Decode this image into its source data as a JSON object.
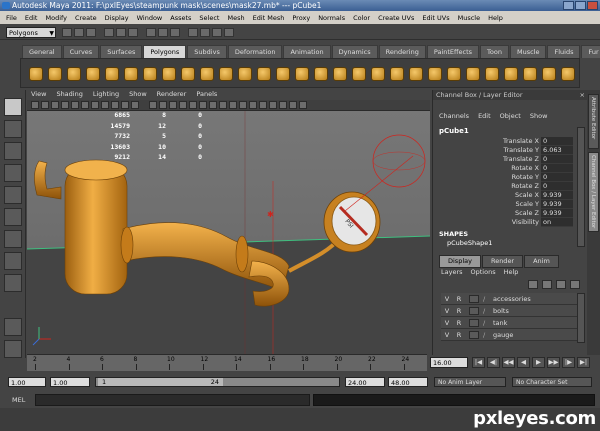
{
  "window": {
    "title": "Autodesk Maya 2011: F:\\pxlEyes\\steampunk mask\\scenes\\mask27.mb*   ---   pCube1"
  },
  "menubar": [
    "File",
    "Edit",
    "Modify",
    "Create",
    "Display",
    "Window",
    "Assets",
    "Select",
    "Mesh",
    "Edit Mesh",
    "Proxy",
    "Normals",
    "Color",
    "Create UVs",
    "Edit UVs",
    "Muscle",
    "Help"
  ],
  "status_line": {
    "mode": "Polygons"
  },
  "shelf": {
    "tabs": [
      "General",
      "Curves",
      "Surfaces",
      "Polygons",
      "Subdivs",
      "Deformation",
      "Animation",
      "Dynamics",
      "Rendering",
      "PaintEffects",
      "Toon",
      "Muscle",
      "Fluids",
      "Fur"
    ],
    "active_tab": "Polygons"
  },
  "viewport": {
    "menu": [
      "View",
      "Shading",
      "Lighting",
      "Show",
      "Renderer",
      "Panels"
    ],
    "hud_rows": [
      [
        "6865",
        "8",
        "0"
      ],
      [
        "14579",
        "12",
        "0"
      ],
      [
        "7732",
        "5",
        "0"
      ],
      [
        "13603",
        "10",
        "0"
      ],
      [
        "9212",
        "14",
        "0"
      ]
    ],
    "gauge_label": "PSI"
  },
  "channel_box": {
    "header": "Channel Box / Layer Editor",
    "menu": [
      "Channels",
      "Edit",
      "Object",
      "Show"
    ],
    "object_name": "pCube1",
    "attributes": [
      {
        "name": "Translate X",
        "value": "0"
      },
      {
        "name": "Translate Y",
        "value": "6.063"
      },
      {
        "name": "Translate Z",
        "value": "0"
      },
      {
        "name": "Rotate X",
        "value": "0"
      },
      {
        "name": "Rotate Y",
        "value": "0"
      },
      {
        "name": "Rotate Z",
        "value": "0"
      },
      {
        "name": "Scale X",
        "value": "9.939"
      },
      {
        "name": "Scale Y",
        "value": "9.939"
      },
      {
        "name": "Scale Z",
        "value": "9.939"
      },
      {
        "name": "Visibility",
        "value": "on"
      }
    ],
    "shapes_label": "SHAPES",
    "shape_name": "pCubeShape1"
  },
  "layer_editor": {
    "tabs": [
      "Display",
      "Render",
      "Anim"
    ],
    "active_tab": "Display",
    "menu": [
      "Layers",
      "Options",
      "Help"
    ],
    "layers": [
      {
        "v": "V",
        "r": "R",
        "name": "accessories"
      },
      {
        "v": "V",
        "r": "R",
        "name": "bolts"
      },
      {
        "v": "V",
        "r": "R",
        "name": "tank"
      },
      {
        "v": "V",
        "r": "R",
        "name": "gauge"
      }
    ]
  },
  "side_tabs": [
    "Attribute Editor",
    "Channel Box / Layer Editor"
  ],
  "time_slider": {
    "ticks": [
      "2",
      "4",
      "6",
      "8",
      "10",
      "12",
      "14",
      "16",
      "18",
      "20",
      "22",
      "24"
    ],
    "current_frame": "16.00"
  },
  "range_slider": {
    "start_time": "1.00",
    "playback_start": "1.00",
    "handle_start": "1",
    "handle_end": "24",
    "playback_end": "24.00",
    "end_time": "48.00",
    "anim_layer": "No Anim Layer",
    "character_set": "No Character Set"
  },
  "command_line": {
    "label": "MEL"
  },
  "watermark": "pxleyes.com",
  "colors": {
    "model_orange": "#e29a2f",
    "grid_green": "#3fbf7f",
    "manipulator_red": "#d0231c"
  }
}
